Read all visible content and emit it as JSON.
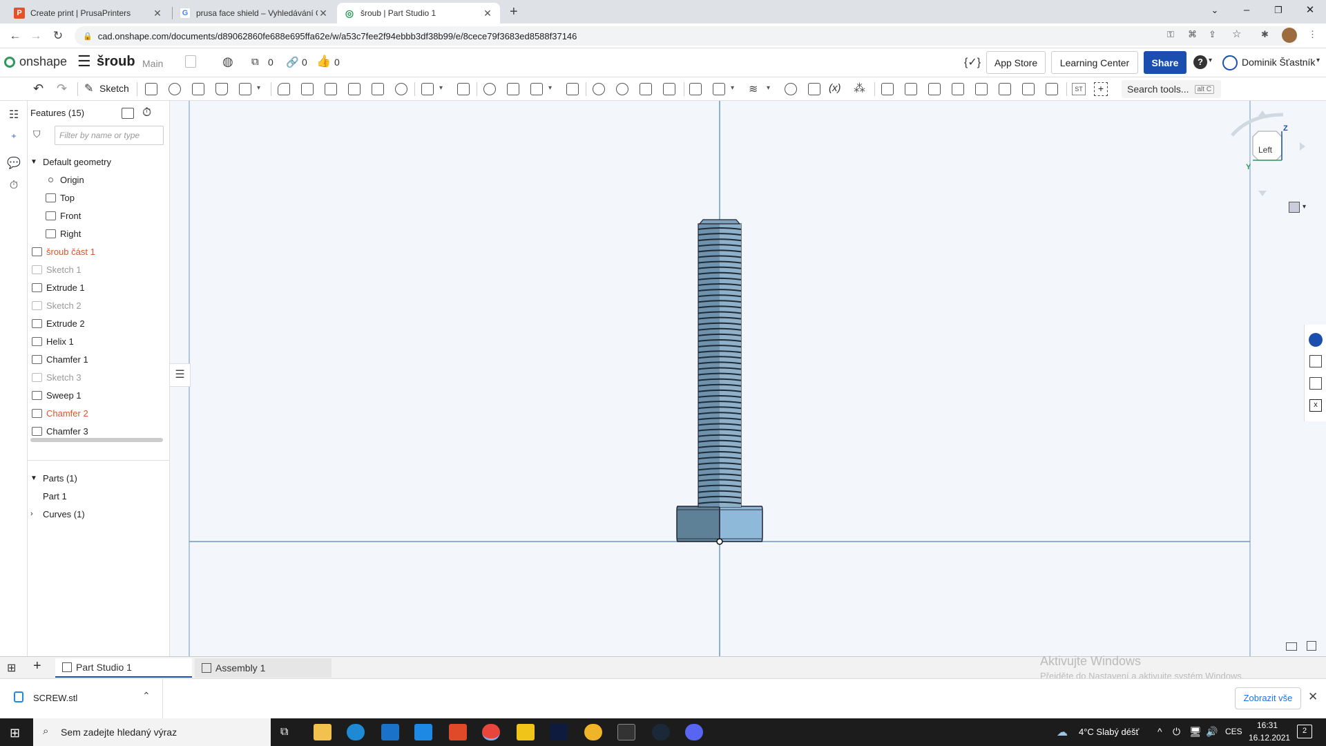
{
  "browser": {
    "tabs": [
      {
        "title": "Create print | PrusaPrinters",
        "icon": "prusa-icon",
        "active": false
      },
      {
        "title": "prusa face shield – Vyhledávání G",
        "icon": "google-icon",
        "active": false
      },
      {
        "title": "šroub | Part Studio 1",
        "icon": "onshape-icon",
        "active": true
      }
    ],
    "url": "cad.onshape.com/documents/d89062860fe688e695ffa62e/w/a53c7fee2f94ebbb3df38b99/e/8cece79f3683ed8588f37146"
  },
  "header": {
    "logo": "onshape",
    "doc_title": "šroub",
    "branch": "Main",
    "versions_count": "0",
    "links_count": "0",
    "likes_count": "0",
    "app_store": "App Store",
    "learning_center": "Learning Center",
    "share": "Share",
    "user": "Dominik Šťastník"
  },
  "toolbar": {
    "sketch": "Sketch",
    "search": "Search tools...",
    "search_shortcut": "alt C"
  },
  "features": {
    "title": "Features (15)",
    "filter_placeholder": "Filter by name or type",
    "default_geometry": "Default geometry",
    "items": [
      {
        "label": "Origin",
        "kind": "origin",
        "state": "normal",
        "indent": 2
      },
      {
        "label": "Top",
        "kind": "plane",
        "state": "normal",
        "indent": 2
      },
      {
        "label": "Front",
        "kind": "plane",
        "state": "normal",
        "indent": 2
      },
      {
        "label": "Right",
        "kind": "plane",
        "state": "normal",
        "indent": 2
      },
      {
        "label": "šroub část 1",
        "kind": "sketch",
        "state": "error",
        "indent": 1
      },
      {
        "label": "Sketch 1",
        "kind": "sketch",
        "state": "dim",
        "indent": 1
      },
      {
        "label": "Extrude 1",
        "kind": "extrude",
        "state": "normal",
        "indent": 1
      },
      {
        "label": "Sketch 2",
        "kind": "sketch",
        "state": "dim",
        "indent": 1
      },
      {
        "label": "Extrude 2",
        "kind": "extrude",
        "state": "normal",
        "indent": 1
      },
      {
        "label": "Helix 1",
        "kind": "helix",
        "state": "normal",
        "indent": 1
      },
      {
        "label": "Chamfer 1",
        "kind": "chamfer",
        "state": "normal",
        "indent": 1
      },
      {
        "label": "Sketch 3",
        "kind": "sketch",
        "state": "dim",
        "indent": 1
      },
      {
        "label": "Sweep 1",
        "kind": "sweep",
        "state": "normal",
        "indent": 1
      },
      {
        "label": "Chamfer 2",
        "kind": "chamfer",
        "state": "error",
        "indent": 1
      },
      {
        "label": "Chamfer 3",
        "kind": "chamfer",
        "state": "normal",
        "indent": 1
      }
    ],
    "parts_header": "Parts (1)",
    "parts": [
      "Part 1"
    ],
    "curves_header": "Curves (1)"
  },
  "viewcube": {
    "face": "Left",
    "axis_z": "Z",
    "axis_y": "Y"
  },
  "bottom_tabs": [
    {
      "label": "Part Studio 1",
      "active": true
    },
    {
      "label": "Assembly 1",
      "active": false
    }
  ],
  "watermark": {
    "title": "Aktivujte Windows",
    "subtitle": "Přejděte do Nastavení a aktivujte systém Windows."
  },
  "download": {
    "file": "SCREW.stl",
    "show_all": "Zobrazit vše"
  },
  "taskbar": {
    "search": "Sem zadejte hledaný výraz",
    "weather": "4°C  Slabý déšť",
    "lang": "CES",
    "time": "16:31",
    "date": "16.12.2021",
    "notifications": "2"
  },
  "colors": {
    "accent": "#1a4fb0",
    "error": "#d4562c",
    "viewport": "#f3f7fb",
    "bolt_light": "#8fb9d9",
    "bolt_dark": "#5e8198",
    "axis": "#6b97c8"
  }
}
